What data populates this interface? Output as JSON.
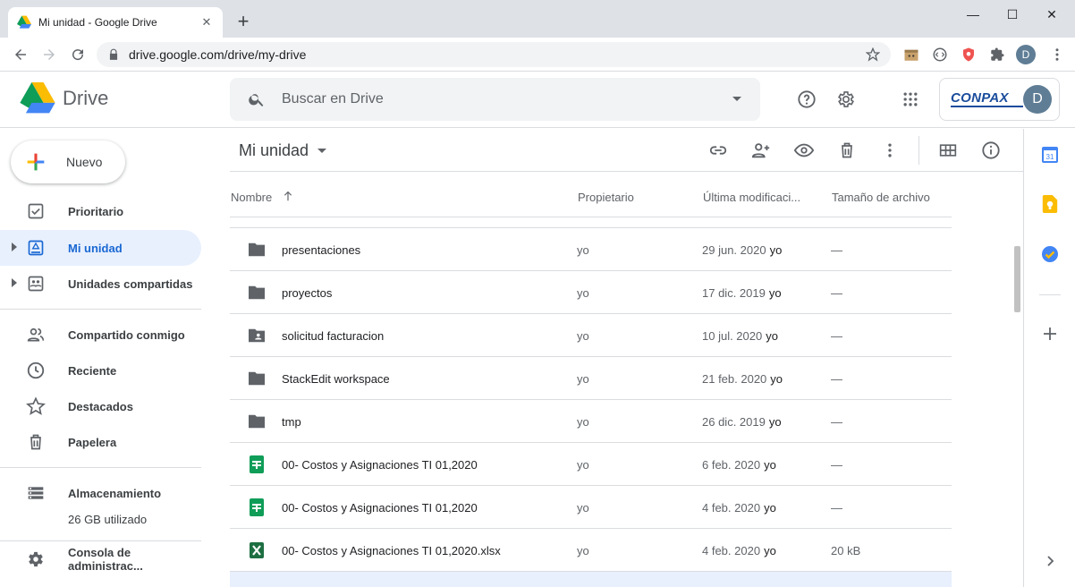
{
  "browser": {
    "tab_title": "Mi unidad - Google Drive",
    "tab_close": "✕",
    "new_tab": "+",
    "url": "drive.google.com/drive/my-drive",
    "profile_initial": "D",
    "window_controls": {
      "minimize": "—",
      "maximize": "☐",
      "close": "✕"
    }
  },
  "header": {
    "app_name": "Drive",
    "search_placeholder": "Buscar en Drive",
    "org_logo_text": "CONPAX",
    "avatar_initial": "D"
  },
  "sidebar": {
    "new_label": "Nuevo",
    "items": [
      {
        "label": "Prioritario",
        "icon": "priority-icon"
      },
      {
        "label": "Mi unidad",
        "icon": "my-drive-icon",
        "active": true
      },
      {
        "label": "Unidades compartidas",
        "icon": "shared-drives-icon"
      },
      {
        "label": "Compartido conmigo",
        "icon": "shared-with-me-icon"
      },
      {
        "label": "Reciente",
        "icon": "clock-icon"
      },
      {
        "label": "Destacados",
        "icon": "star-icon"
      },
      {
        "label": "Papelera",
        "icon": "trash-icon"
      },
      {
        "label": "Almacenamiento",
        "icon": "storage-icon"
      },
      {
        "label": "Consola de administrac...",
        "icon": "admin-console-icon"
      }
    ],
    "storage_used": "26 GB utilizado"
  },
  "main": {
    "breadcrumb": "Mi unidad",
    "columns": {
      "name": "Nombre",
      "owner": "Propietario",
      "modified": "Última modificaci...",
      "size": "Tamaño de archivo"
    },
    "rows": [
      {
        "name": "presentaciones",
        "type": "folder",
        "owner": "yo",
        "modified": "29 jun. 2020",
        "modified_by": "yo",
        "size": "—"
      },
      {
        "name": "proyectos",
        "type": "folder",
        "owner": "yo",
        "modified": "17 dic. 2019",
        "modified_by": "yo",
        "size": "—"
      },
      {
        "name": "solicitud facturacion",
        "type": "shared-folder",
        "owner": "yo",
        "modified": "10 jul. 2020",
        "modified_by": "yo",
        "size": "—"
      },
      {
        "name": "StackEdit workspace",
        "type": "folder",
        "owner": "yo",
        "modified": "21 feb. 2020",
        "modified_by": "yo",
        "size": "—"
      },
      {
        "name": "tmp",
        "type": "folder",
        "owner": "yo",
        "modified": "26 dic. 2019",
        "modified_by": "yo",
        "size": "—"
      },
      {
        "name": "00- Costos y Asignaciones TI 01,2020",
        "type": "sheet",
        "owner": "yo",
        "modified": "6 feb. 2020",
        "modified_by": "yo",
        "size": "—"
      },
      {
        "name": "00- Costos y Asignaciones TI 01,2020",
        "type": "sheet",
        "owner": "yo",
        "modified": "4 feb. 2020",
        "modified_by": "yo",
        "size": "—"
      },
      {
        "name": "00- Costos y Asignaciones TI 01,2020.xlsx",
        "type": "excel",
        "owner": "yo",
        "modified": "4 feb. 2020",
        "modified_by": "yo",
        "size": "20 kB"
      }
    ]
  },
  "colors": {
    "active_bg": "#e8f0fe",
    "active_text": "#1967d2",
    "folder": "#5f6368",
    "sheet": "#0f9d58",
    "excel": "#1d6f42"
  }
}
